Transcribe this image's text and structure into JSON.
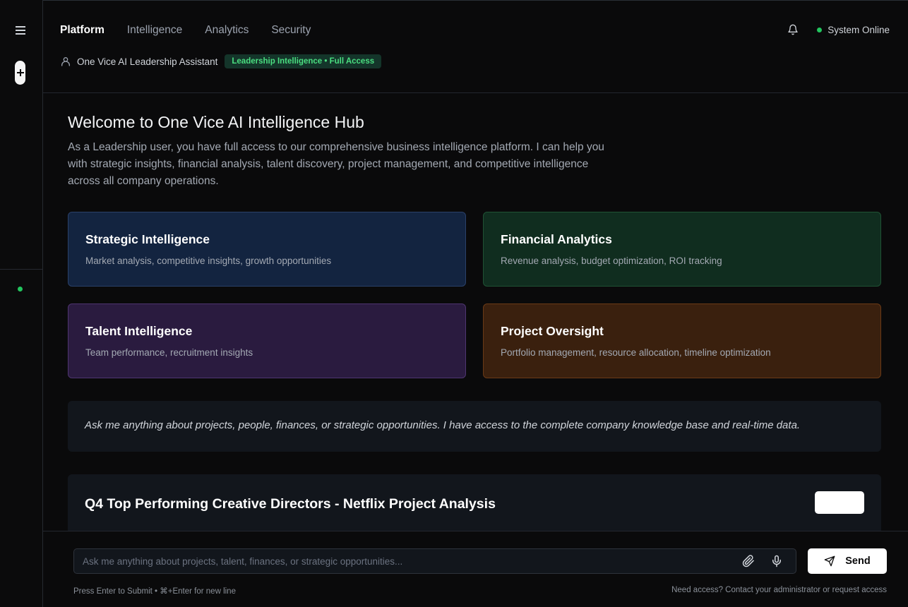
{
  "nav": {
    "tabs": [
      {
        "label": "Platform",
        "active": true
      },
      {
        "label": "Intelligence",
        "active": false
      },
      {
        "label": "Analytics",
        "active": false
      },
      {
        "label": "Security",
        "active": false
      }
    ]
  },
  "header": {
    "assistant_label": "One Vice AI Leadership Assistant",
    "access_badge": "Leadership Intelligence • Full Access",
    "status_text": "System Online"
  },
  "welcome": {
    "title": "Welcome to One Vice AI Intelligence Hub",
    "text": "As a Leadership user, you have full access to our comprehensive business intelligence platform. I can help you with strategic insights, financial analysis, talent discovery, project management, and competitive intelligence across all company operations."
  },
  "cards": [
    {
      "title": "Strategic Intelligence",
      "subtitle": "Market analysis, competitive insights, growth opportunities"
    },
    {
      "title": "Financial Analytics",
      "subtitle": "Revenue analysis, budget optimization, ROI tracking"
    },
    {
      "title": "Talent Intelligence",
      "subtitle": "Team performance, recruitment insights"
    },
    {
      "title": "Project Oversight",
      "subtitle": "Portfolio management, resource allocation, timeline optimization"
    }
  ],
  "prompt_text": "Ask me anything about projects, people, finances, or strategic opportunities. I have access to the complete company knowledge base and real-time data.",
  "report": {
    "title": "Q4 Top Performing Creative Directors - Netflix Project Analysis"
  },
  "input": {
    "placeholder": "Ask me anything about projects, talent, finances, or strategic opportunities...",
    "value": "",
    "send_label": "Send",
    "hint_left": "Press Enter to Submit • ⌘+Enter for new line",
    "hint_right": "Need access? Contact your administrator or request access"
  },
  "colors": {
    "accent_green": "#22c55e",
    "strategic": "#132440",
    "financial": "#102d1f",
    "talent": "#2a1b3f",
    "project": "#3a200e"
  },
  "icons": [
    "menu-icon",
    "plus-icon",
    "bell-icon",
    "user-icon",
    "paperclip-icon",
    "microphone-icon",
    "send-icon"
  ]
}
